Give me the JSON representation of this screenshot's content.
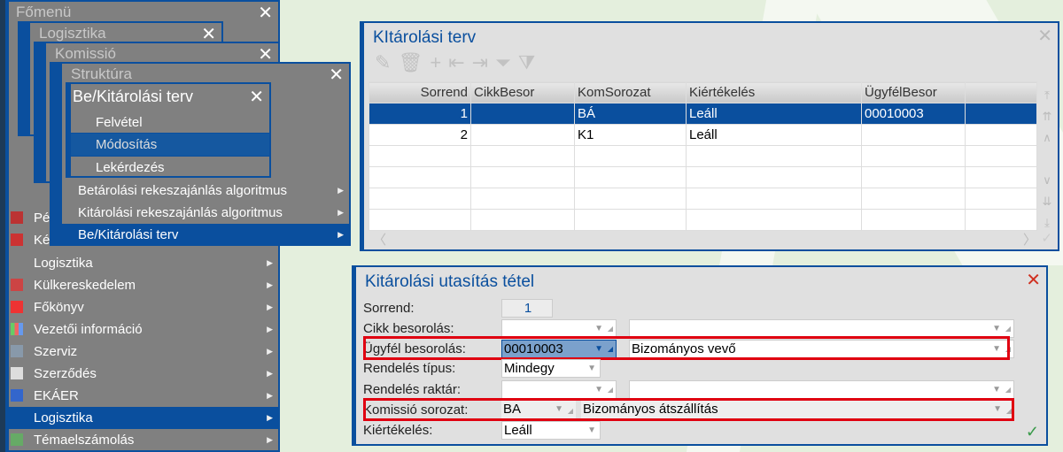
{
  "menus": {
    "fomenu": {
      "title": "Főmenü",
      "items": [
        {
          "label": "Pé"
        },
        {
          "label": "Ké"
        },
        {
          "label": "Logisztika"
        },
        {
          "label": "Külkereskedelem"
        },
        {
          "label": "Főkönyv"
        },
        {
          "label": "Vezetői információ"
        },
        {
          "label": "Szerviz"
        },
        {
          "label": "Szerződés"
        },
        {
          "label": "EKÁER"
        },
        {
          "label": "Logisztika"
        },
        {
          "label": "Témaelszámolás"
        }
      ]
    },
    "logisztika": {
      "title": "Logisztika"
    },
    "komissio": {
      "title": "Komissió"
    },
    "struktura": {
      "title": "Struktúra",
      "items": [
        {
          "label": "Betárolási rekeszajánlás algoritmus"
        },
        {
          "label": "Kitárolási rekeszajánlás algoritmus"
        },
        {
          "label": "Be/Kitárolási terv"
        }
      ]
    },
    "terv": {
      "title": "Be/Kitárolási terv",
      "items": [
        {
          "label": "Felvétel"
        },
        {
          "label": "Módosítás"
        },
        {
          "label": "Lekérdezés"
        }
      ]
    }
  },
  "grid": {
    "title": "KItárolási terv",
    "columns": [
      "Sorrend",
      "CikkBesor",
      "KomSorozat",
      "Kiértékelés",
      "ÜgyfélBesor",
      ""
    ],
    "rows": [
      [
        "1",
        "",
        "BÁ",
        "Leáll",
        "00010003",
        ""
      ],
      [
        "2",
        "",
        "K1",
        "Leáll",
        "",
        ""
      ],
      [
        "",
        "",
        "",
        "",
        "",
        ""
      ],
      [
        "",
        "",
        "",
        "",
        "",
        ""
      ],
      [
        "",
        "",
        "",
        "",
        "",
        ""
      ],
      [
        "",
        "",
        "",
        "",
        "",
        ""
      ]
    ]
  },
  "form": {
    "title": "Kitárolási utasítás tétel",
    "sorrend_label": "Sorrend:",
    "sorrend": "1",
    "cikk_label": "Cikk besorolás:",
    "cikk_code": "",
    "cikk_name": "",
    "ugyfel_label": "Ügyfél besorolás:",
    "ugyfel_code": "00010003",
    "ugyfel_name": "Bizományos vevő",
    "tipus_label": "Rendelés típus:",
    "tipus": "Mindegy",
    "raktar_label": "Rendelés raktár:",
    "raktar_code": "",
    "raktar_name": "",
    "komissio_label": "Komissió sorozat:",
    "komissio_code": "BA",
    "komissio_name": "Bizományos átszállítás",
    "kiert_label": "Kiértékelés:",
    "kiert": "Leáll"
  },
  "colors": {
    "accent": "#0a4f9e",
    "highlight": "#e00010"
  }
}
